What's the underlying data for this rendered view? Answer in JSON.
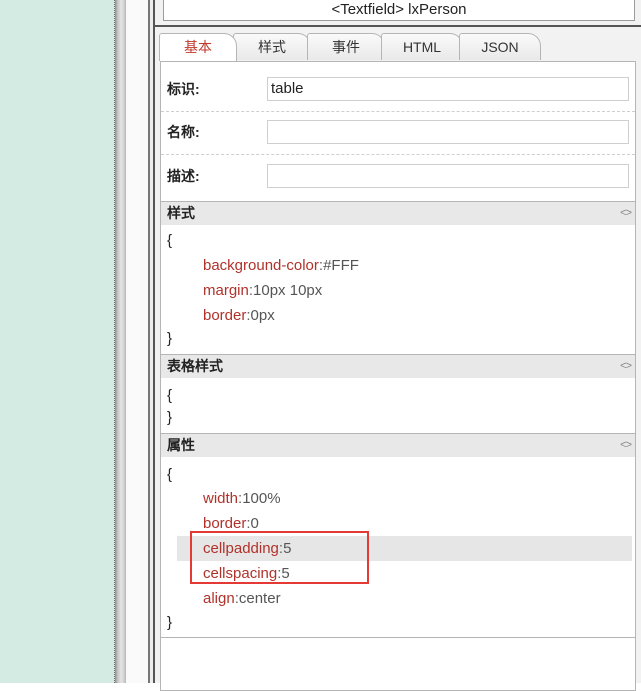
{
  "header": {
    "node_label": "<Textfield> lxPerson"
  },
  "tabs": [
    {
      "label": "基本",
      "active": true
    },
    {
      "label": "样式"
    },
    {
      "label": "事件"
    },
    {
      "label": "HTML"
    },
    {
      "label": "JSON"
    }
  ],
  "basic": {
    "fields": [
      {
        "label": "标识:",
        "value": "table"
      },
      {
        "label": "名称:",
        "value": ""
      },
      {
        "label": "描述:",
        "value": ""
      }
    ]
  },
  "sections": {
    "style": {
      "title": "样式",
      "toggle": "<>",
      "open": "{",
      "close": "}",
      "props": [
        {
          "key": "background-color",
          "sep": ":",
          "value": "#FFF"
        },
        {
          "key": "margin",
          "sep": ":",
          "value": "10px 10px"
        },
        {
          "key": "border",
          "sep": ":",
          "value": "0px"
        }
      ]
    },
    "table_style": {
      "title": "表格样式",
      "toggle": "<>",
      "open": "{",
      "close": "}"
    },
    "attributes": {
      "title": "属性",
      "toggle": "<>",
      "open": "{",
      "close": "}",
      "props": [
        {
          "key": "width",
          "sep": ":",
          "value": "100%"
        },
        {
          "key": "border",
          "sep": ":",
          "value": "0"
        },
        {
          "key": "cellpadding",
          "sep": ":",
          "value": "5"
        },
        {
          "key": "cellspacing",
          "sep": ":",
          "value": "5"
        },
        {
          "key": "align",
          "sep": ":",
          "value": "center"
        }
      ]
    }
  },
  "colors": {
    "canvas_bg": "#d3ebe3",
    "active_tab": "#c0392b",
    "prop_key": "#b0322a",
    "highlight_box": "#e53935"
  }
}
